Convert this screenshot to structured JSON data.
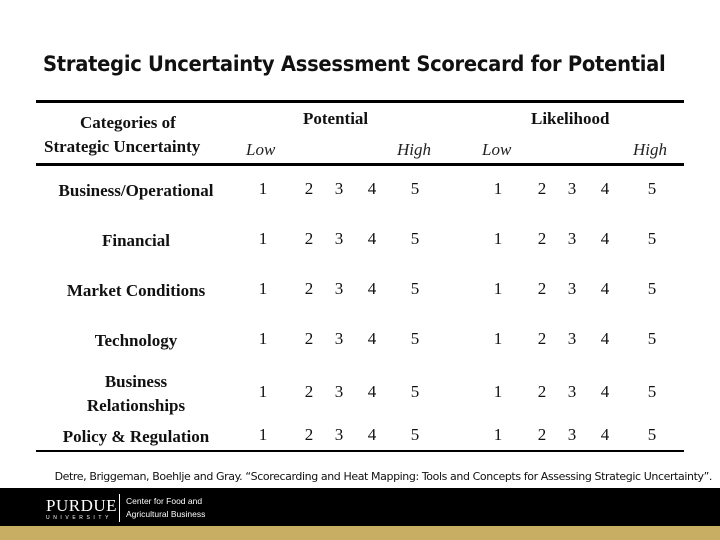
{
  "title": "Strategic Uncertainty Assessment Scorecard for Potential",
  "table": {
    "header": {
      "category_line1": "Categories of",
      "category_line2": "Strategic Uncertainty",
      "potential": "Potential",
      "likelihood": "Likelihood",
      "potential_low": "Low",
      "potential_high": "High",
      "likelihood_low": "Low",
      "likelihood_high": "High"
    },
    "scale": [
      "1",
      "2",
      "3",
      "4",
      "5"
    ],
    "rows": [
      {
        "category": "Business/Operational"
      },
      {
        "category": "Financial"
      },
      {
        "category": "Market Conditions"
      },
      {
        "category": "Technology"
      },
      {
        "category_line1": "Business",
        "category_line2": "Relationships"
      },
      {
        "category": "Policy & Regulation"
      }
    ]
  },
  "citation": "Detre, Briggeman, Boehlje and Gray. “Scorecarding and Heat Mapping: Tools and Concepts for Assessing Strategic Uncertainty”.",
  "footer": {
    "logo_word": "PURDUE",
    "logo_sub": "UNIVERSITY",
    "center_line1": "Center for Food and",
    "center_line2": "Agricultural Business",
    "colors": {
      "band": "#000000",
      "gold": "#c8ae62"
    }
  }
}
